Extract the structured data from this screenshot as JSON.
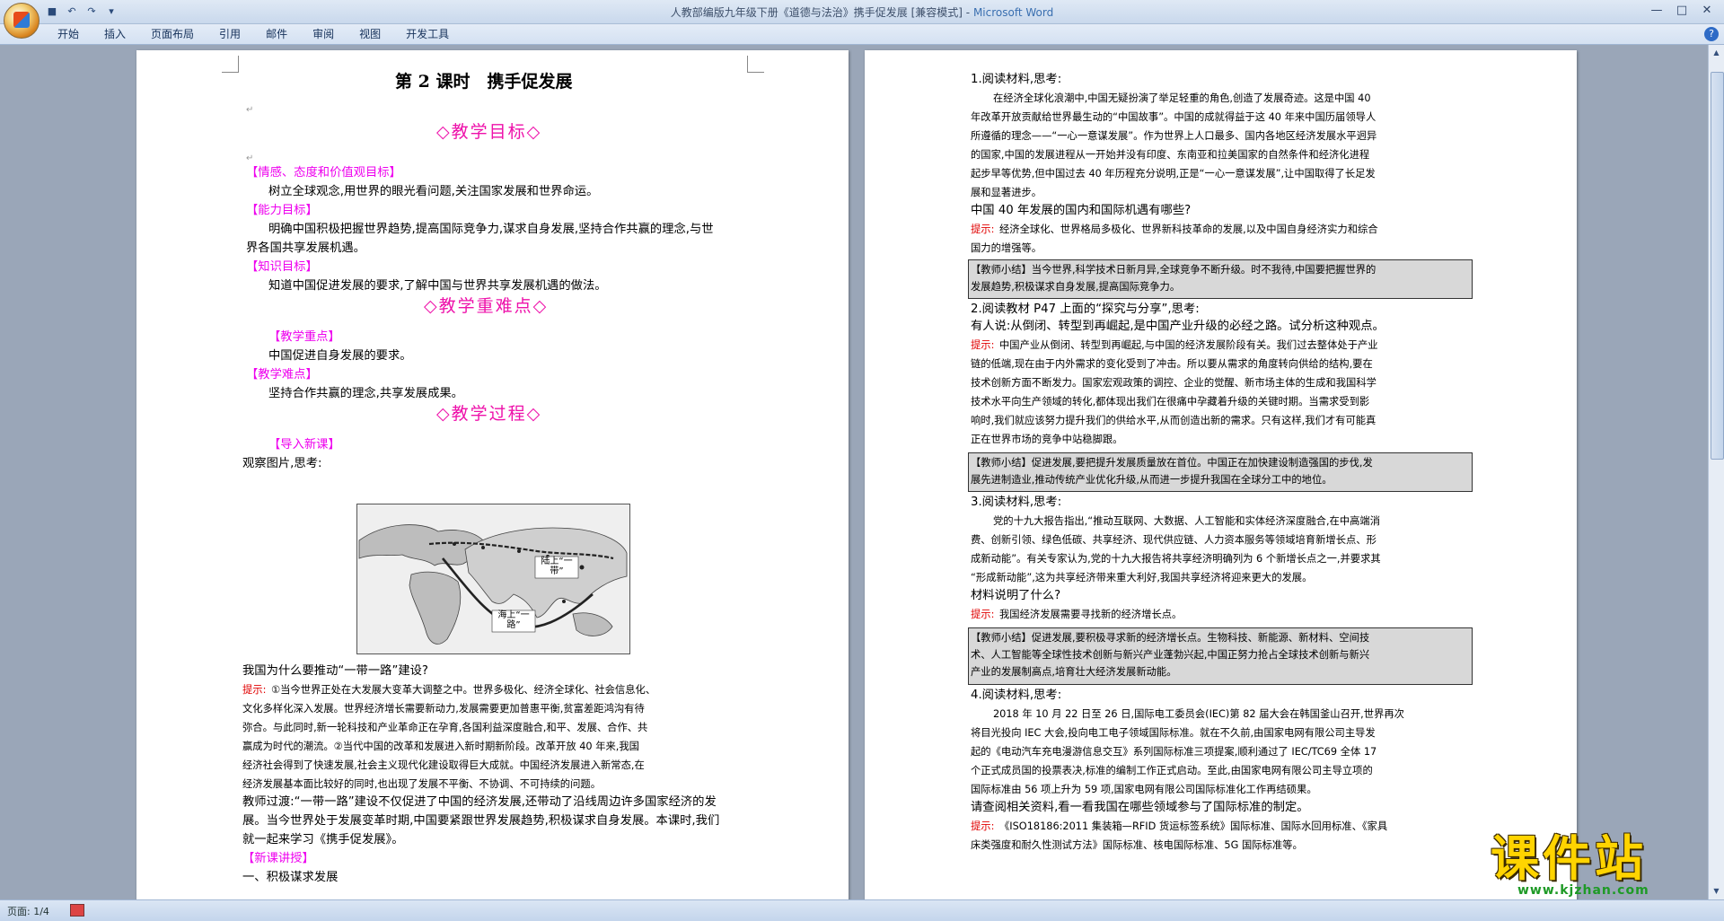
{
  "titlebar": {
    "title": "人教部编版九年级下册《道德与法治》携手促发展 [兼容模式] -",
    "app": "Microsoft Word"
  },
  "window_controls": {
    "minimize": "—",
    "maximize": "□",
    "close": "✕"
  },
  "qat": [
    "save-icon",
    "undo-icon",
    "redo-icon"
  ],
  "ribbon": {
    "tabs": [
      "开始",
      "插入",
      "页面布局",
      "引用",
      "邮件",
      "审阅",
      "视图",
      "开发工具"
    ],
    "help": "?"
  },
  "page1": {
    "title": "第 2 课时　携手促发展",
    "h_goals": "◇教学目标◇",
    "l_emotion": "【情感、态度和价值观目标】",
    "emotion": "树立全球观念,用世界的眼光看问题,关注国家发展和世界命运。",
    "l_ability": "【能力目标】",
    "ability_1": "明确中国积极把握世界趋势,提高国际竞争力,谋求自身发展,坚持合作共赢的理念,与世",
    "ability_2": "界各国共享发展机遇。",
    "l_knowledge": "【知识目标】",
    "knowledge": "知道中国促进发展的要求,了解中国与世界共享发展机遇的做法。",
    "h_key": "◇教学重难点◇",
    "l_key": "【教学重点】",
    "key": "中国促进自身发展的要求。",
    "l_diff": "【教学难点】",
    "diff": "坚持合作共赢的理念,共享发展成果。",
    "h_process": "◇教学过程◇",
    "l_intro": "【导入新课】",
    "observe": "观察图片,思考:",
    "map_labels": {
      "land": "陆上“一带”",
      "sea": "海上“一路”"
    },
    "question": "我国为什么要推动“一带一路”建设?",
    "hint_label": "提示:",
    "hint_lines": [
      "①当今世界正处在大发展大变革大调整之中。世界多极化、经济全球化、社会信息化、",
      "文化多样化深入发展。世界经济增长需要新动力,发展需要更加普惠平衡,贫富差距鸿沟有待",
      "弥合。与此同时,新一轮科技和产业革命正在孕育,各国利益深度融合,和平、发展、合作、共",
      "赢成为时代的潮流。②当代中国的改革和发展进入新时期新阶段。改革开放 40 年来,我国",
      "经济社会得到了快速发展,社会主义现代化建设取得巨大成就。中国经济发展进入新常态,在",
      "经济发展基本面比较好的同时,也出现了发展不平衡、不协调、不可持续的问题。"
    ],
    "transition": [
      "教师过渡:“一带一路”建设不仅促进了中国的经济发展,还带动了沿线周边许多国家经济的发",
      "展。当今世界处于发展变革时期,中国要紧跟世界发展趋势,积极谋求自身发展。本课时,我们",
      "就一起来学习《携手促发展》。"
    ],
    "l_new": "【新课讲授】",
    "section1": "一、积极谋求发展"
  },
  "page2": {
    "q1": "1.阅读材料,思考:",
    "q1_mat": [
      "在经济全球化浪潮中,中国无疑扮演了举足轻重的角色,创造了发展奇迹。这是中国 40",
      "年改革开放贡献给世界最生动的“中国故事”。中国的成就得益于这 40 年来中国历届领导人",
      "所遵循的理念——“一心一意谋发展”。作为世界上人口最多、国内各地区经济发展水平迥异",
      "的国家,中国的发展进程从一开始并没有印度、东南亚和拉美国家的自然条件和经济化进程",
      "起步早等优势,但中国过去 40 年历程充分说明,正是“一心一意谋发展”,让中国取得了长足发",
      "展和显著进步。"
    ],
    "q1_question": "中国 40 年发展的国内和国际机遇有哪些?",
    "q1_hint_label": "提示:",
    "q1_hint": [
      "经济全球化、世界格局多极化、世界新科技革命的发展,以及中国自身经济实力和综合",
      "国力的增强等。"
    ],
    "s1": [
      "【教师小结】当今世界,科学技术日新月异,全球竞争不断升级。时不我待,中国要把握世界的",
      "发展趋势,积极谋求自身发展,提高国际竞争力。"
    ],
    "q2": "2.阅读教材 P47 上面的“探究与分享”,思考:",
    "q2_question": "有人说:从倒闭、转型到再崛起,是中国产业升级的必经之路。试分析这种观点。",
    "q2_hint_label": "提示:",
    "q2_hint": [
      "中国产业从倒闭、转型到再崛起,与中国的经济发展阶段有关。我们过去整体处于产业",
      "链的低端,现在由于内外需求的变化受到了冲击。所以要从需求的角度转向供给的结构,要在",
      "技术创新方面不断发力。国家宏观政策的调控、企业的觉醒、新市场主体的生成和我国科学",
      "技术水平向生产领域的转化,都体现出我们在很痛中孕藏着升级的关键时期。当需求受到影",
      "响时,我们就应该努力提升我们的供给水平,从而创造出新的需求。只有这样,我们才有可能真",
      "正在世界市场的竞争中站稳脚跟。"
    ],
    "s2": [
      "【教师小结】促进发展,要把提升发展质量放在首位。中国正在加快建设制造强国的步伐,发",
      "展先进制造业,推动传统产业优化升级,从而进一步提升我国在全球分工中的地位。"
    ],
    "q3": "3.阅读材料,思考:",
    "q3_mat": [
      "党的十九大报告指出,“推动互联网、大数据、人工智能和实体经济深度融合,在中高端消",
      "费、创新引领、绿色低碳、共享经济、现代供应链、人力资本服务等领域培育新增长点、形",
      "成新动能”。有关专家认为,党的十九大报告将共享经济明确列为 6 个新增长点之一,并要求其",
      "“形成新动能”,这为共享经济带来重大利好,我国共享经济将迎来更大的发展。"
    ],
    "q3_question": "材料说明了什么?",
    "q3_hint_label": "提示:",
    "q3_hint": "我国经济发展需要寻找新的经济增长点。",
    "s3": [
      "【教师小结】促进发展,要积极寻求新的经济增长点。生物科技、新能源、新材料、空间技",
      "术、人工智能等全球性技术创新与新兴产业蓬勃兴起,中国正努力抢占全球技术创新与新兴",
      "产业的发展制高点,培育壮大经济发展新动能。"
    ],
    "q4": "4.阅读材料,思考:",
    "q4_mat": [
      "2018 年 10 月 22 日至 26 日,国际电工委员会(IEC)第 82 届大会在韩国釜山召开,世界再次",
      "将目光投向 IEC 大会,投向电工电子领域国际标准。就在不久前,由国家电网有限公司主导发",
      "起的《电动汽车充电漫游信息交互》系列国际标准三项提案,顺利通过了 IEC/TC69 全体 17",
      "个正式成员国的投票表决,标准的编制工作正式启动。至此,由国家电网有限公司主导立项的",
      "国际标准由 56 项上升为 59 项,国家电网有限公司国际标准化工作再结硕果。"
    ],
    "q4_question": "请查阅相关资料,看一看我国在哪些领域参与了国际标准的制定。",
    "q4_hint_label": "提示:",
    "q4_hint": [
      "《ISO18186:2011 集装箱—RFID 货运标签系统》国际标准、国际水回用标准、《家具",
      "床类强度和耐久性测试方法》国际标准、核电国际标准、5G 国际标准等。"
    ]
  },
  "statusbar": {
    "page": "页面: 1/4"
  },
  "watermark": {
    "big": "课件站",
    "url": "www.kjzhan.com"
  }
}
